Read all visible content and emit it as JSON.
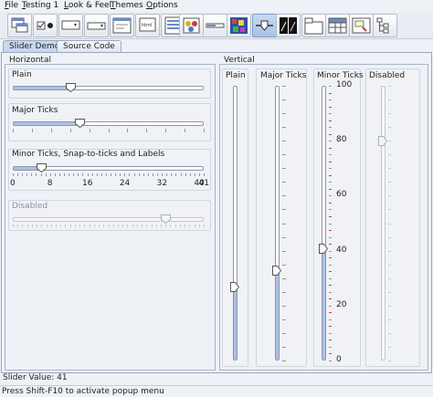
{
  "menu": [
    {
      "label": "File",
      "mnemonic": "F",
      "rest": "ile"
    },
    {
      "label": "Testing 1",
      "mnemonic": "T",
      "rest": "esting 1"
    },
    {
      "label": "Look & Feel",
      "mnemonic": "L",
      "rest": "ook & Feel"
    },
    {
      "label": "Themes",
      "mnemonic": "T",
      "rest": "hemes"
    },
    {
      "label": "Options",
      "mnemonic": "O",
      "rest": "ptions"
    }
  ],
  "toolbar": {
    "buttons": [
      {
        "icon": "internal-frame-demo-icon"
      },
      {
        "icon": "button-demo-icon"
      },
      {
        "icon": "color-chooser-demo-icon"
      },
      {
        "icon": "combobox-demo-icon"
      },
      {
        "icon": "file-chooser-demo-icon"
      },
      {
        "icon": "html-demo-icon"
      },
      {
        "icon": "list-demo-icon"
      },
      {
        "icon": "option-pane-demo-icon"
      },
      {
        "icon": "progress-bar-demo-icon"
      },
      {
        "icon": "scroll-pane-demo-icon"
      },
      {
        "icon": "slider-demo-icon",
        "active": true
      },
      {
        "icon": "split-pane-demo-icon"
      },
      {
        "icon": "tabbed-pane-demo-icon"
      },
      {
        "icon": "table-demo-icon"
      },
      {
        "icon": "tooltip-demo-icon"
      },
      {
        "icon": "tree-demo-icon"
      }
    ]
  },
  "tabs": [
    {
      "label": "Slider Demo",
      "selected": true
    },
    {
      "label": "Source Code",
      "selected": false
    }
  ],
  "horizontal": {
    "title": "Horizontal",
    "plain": {
      "label": "Plain",
      "value_fraction": 0.3
    },
    "major": {
      "label": "Major Ticks",
      "value_fraction": 0.35
    },
    "minor": {
      "label": "Minor Ticks, Snap-to-ticks and Labels",
      "value": 6,
      "min": 0,
      "max": 41,
      "tick_labels": [
        "0",
        "8",
        "16",
        "24",
        "32",
        "40",
        "41"
      ]
    },
    "disabled": {
      "label": "Disabled",
      "value_fraction": 0.8
    }
  },
  "vertical": {
    "title": "Vertical",
    "plain": {
      "label": "Plain",
      "value_fraction": 0.27
    },
    "major": {
      "label": "Major Ticks",
      "value_fraction": 0.33
    },
    "minor": {
      "label": "Minor Ticks",
      "value": 41,
      "min": 0,
      "max": 100,
      "tick_labels": [
        "100",
        "80",
        "60",
        "40",
        "20",
        "0"
      ]
    },
    "disabled": {
      "label": "Disabled",
      "value_fraction": 0.8
    }
  },
  "status": {
    "slider_value": "Slider Value: 41",
    "hint": "Press Shift-F10 to activate popup menu"
  },
  "colors": {
    "accent": "#aac1e4",
    "thumb": "#ffffff",
    "minor_tick_red": "#d04040"
  }
}
